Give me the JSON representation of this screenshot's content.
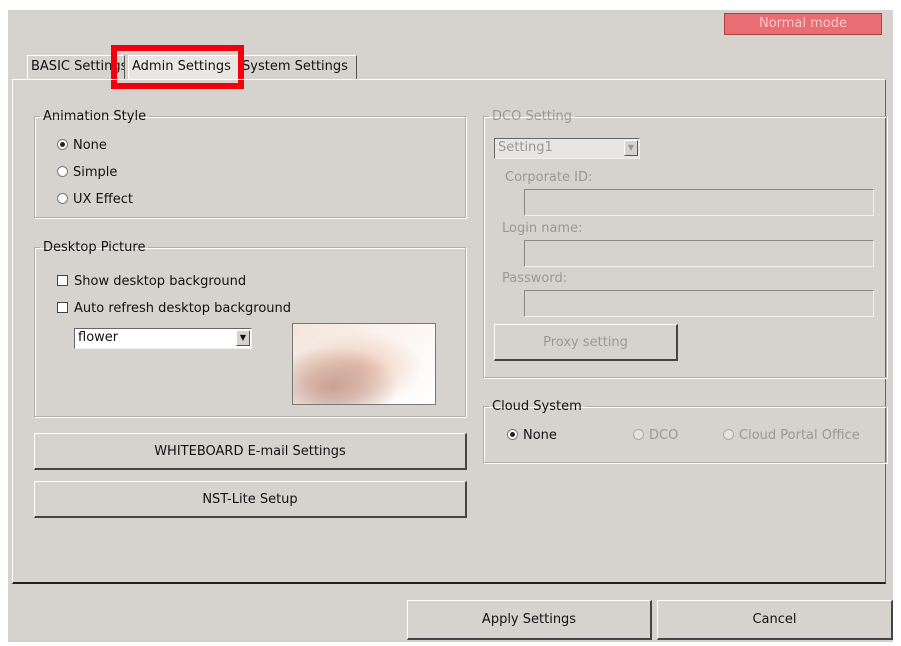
{
  "header": {
    "mode_badge": "Normal mode"
  },
  "tabs": [
    {
      "label": "BASIC Settings"
    },
    {
      "label": "Admin Settings"
    },
    {
      "label": "System Settings"
    }
  ],
  "animation_style": {
    "legend": "Animation Style",
    "options": [
      {
        "label": "None",
        "selected": true
      },
      {
        "label": "Simple",
        "selected": false
      },
      {
        "label": "UX Effect",
        "selected": false
      }
    ]
  },
  "desktop_picture": {
    "legend": "Desktop Picture",
    "show_background_label": "Show desktop background",
    "auto_refresh_label": "Auto refresh desktop background",
    "picture_select": "flower"
  },
  "buttons": {
    "whiteboard_email": "WHITEBOARD E-mail Settings",
    "nst_lite": "NST-Lite Setup",
    "apply": "Apply Settings",
    "cancel": "Cancel"
  },
  "dco_setting": {
    "legend": "DCO Setting",
    "setting_select": "Setting1",
    "corporate_id_label": "Corporate ID:",
    "corporate_id_value": "",
    "login_name_label": "Login name:",
    "login_name_value": "",
    "password_label": "Password:",
    "password_value": "",
    "proxy_button": "Proxy setting"
  },
  "cloud_system": {
    "legend": "Cloud System",
    "options": [
      {
        "label": "None",
        "selected": true,
        "enabled": true
      },
      {
        "label": "DCO",
        "selected": false,
        "enabled": false
      },
      {
        "label": "Cloud Portal Office",
        "selected": false,
        "enabled": false
      }
    ]
  },
  "colors": {
    "window_bg": "#d6d3ce",
    "mode_badge_bg": "#e96d72",
    "highlight_border": "#f2000d"
  }
}
